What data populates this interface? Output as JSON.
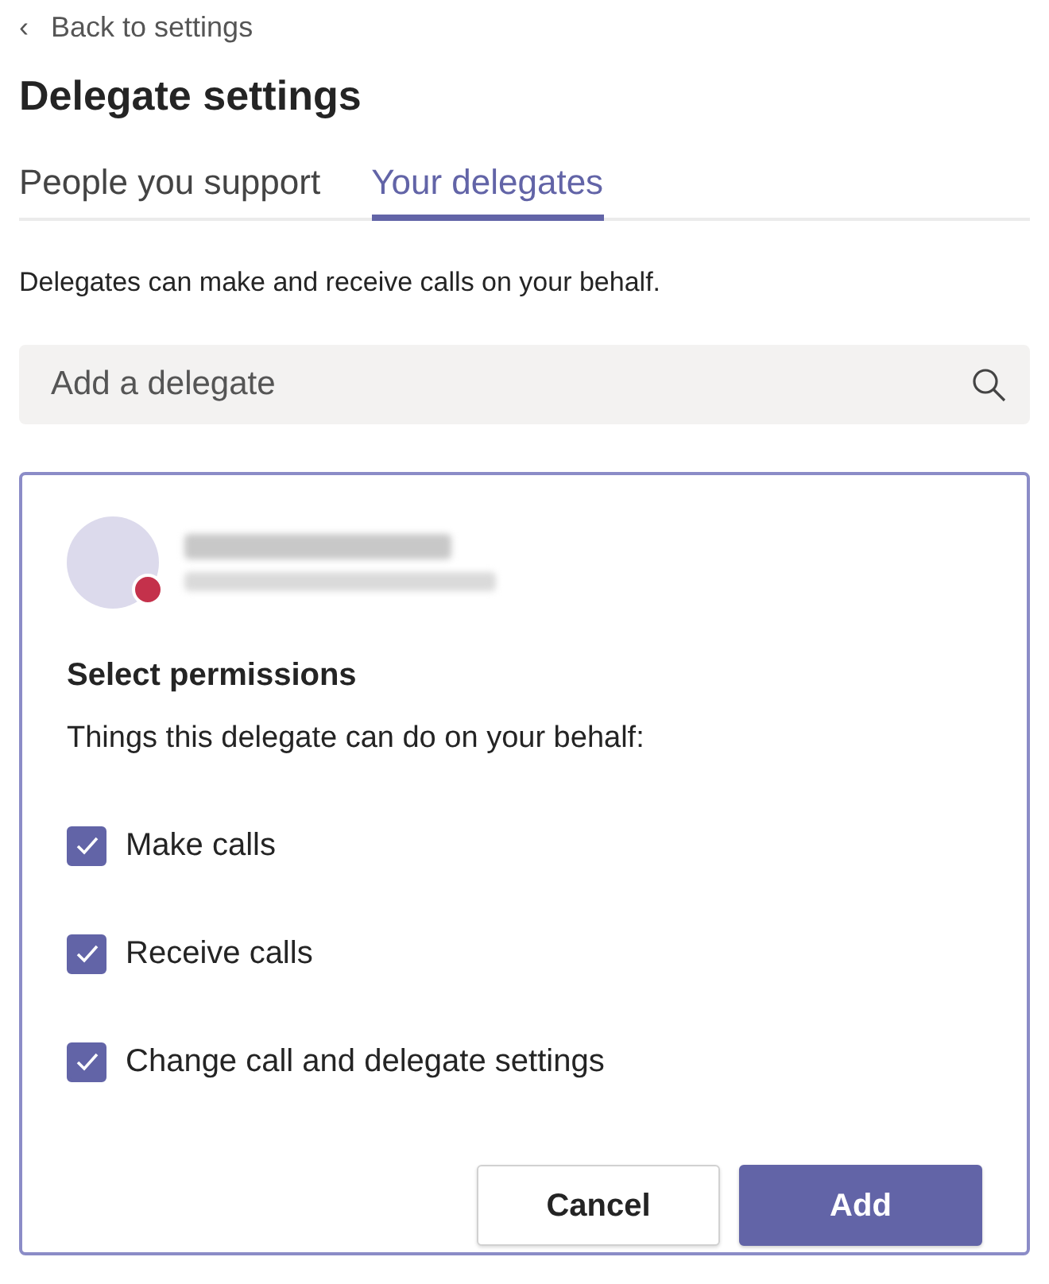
{
  "back_link": {
    "icon": "‹",
    "label": "Back to settings"
  },
  "title": "Delegate settings",
  "tabs": [
    {
      "label": "People you support",
      "selected": false
    },
    {
      "label": "Your delegates",
      "selected": true
    }
  ],
  "description": "Delegates can make and receive calls on your behalf.",
  "search": {
    "placeholder": "Add a delegate"
  },
  "delegate_card": {
    "presence": {
      "color": "#c4314b"
    },
    "permissions_title": "Select permissions",
    "permissions_subtitle": "Things this delegate can do on your behalf:",
    "permissions": [
      {
        "label": "Make calls",
        "checked": true
      },
      {
        "label": "Receive calls",
        "checked": true
      },
      {
        "label": "Change call and delegate settings",
        "checked": true
      }
    ],
    "buttons": [
      {
        "label": "Cancel",
        "kind": "secondary"
      },
      {
        "label": "Add",
        "kind": "primary"
      }
    ]
  }
}
